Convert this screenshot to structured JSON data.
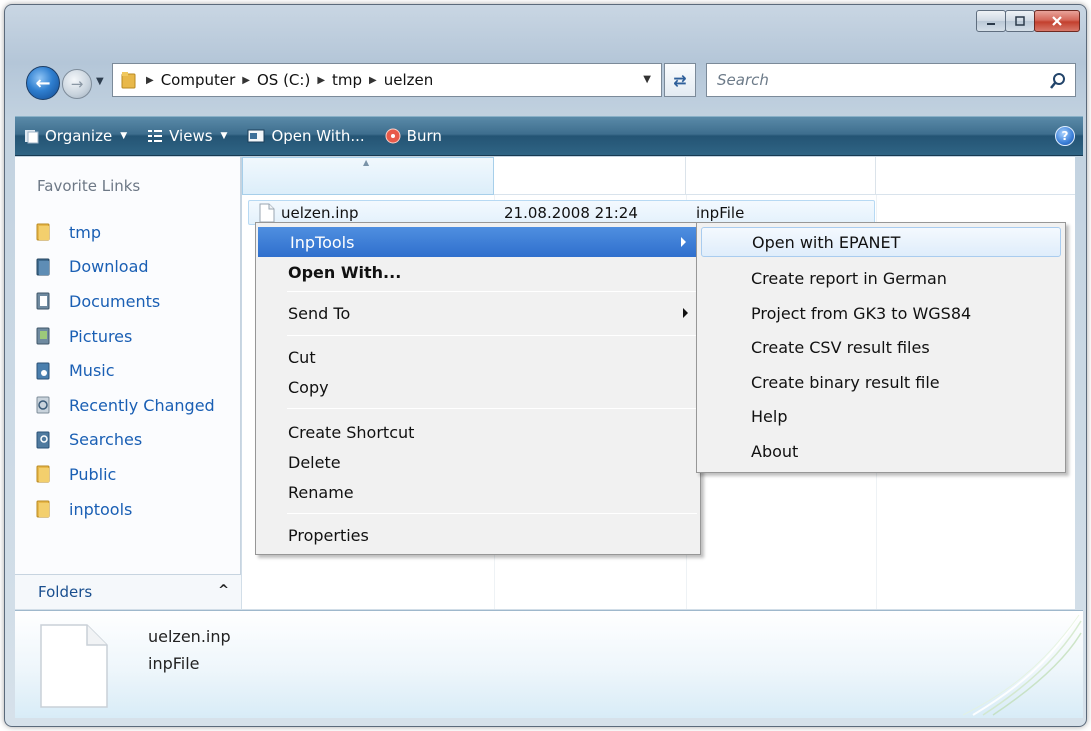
{
  "window": {
    "caption_buttons": {
      "minimize": "minimize-icon",
      "maximize": "maximize-icon",
      "close": "close-icon"
    }
  },
  "address_bar": {
    "crumbs": [
      "Computer",
      "OS (C:)",
      "tmp",
      "uelzen"
    ],
    "search_placeholder": "Search"
  },
  "toolbar": {
    "organize": "Organize",
    "views": "Views",
    "open_with": "Open With...",
    "burn": "Burn",
    "help": "?"
  },
  "sidebar": {
    "favorites_title": "Favorite Links",
    "items": [
      {
        "label": "tmp",
        "icon": "folder-icon"
      },
      {
        "label": "Download",
        "icon": "download-folder-icon"
      },
      {
        "label": "Documents",
        "icon": "documents-folder-icon"
      },
      {
        "label": "Pictures",
        "icon": "pictures-folder-icon"
      },
      {
        "label": "Music",
        "icon": "music-folder-icon"
      },
      {
        "label": "Recently Changed",
        "icon": "recent-folder-icon"
      },
      {
        "label": "Searches",
        "icon": "searches-folder-icon"
      },
      {
        "label": "Public",
        "icon": "folder-icon"
      },
      {
        "label": "inptools",
        "icon": "folder-icon"
      }
    ],
    "folders_label": "Folders"
  },
  "file_list": {
    "rows": [
      {
        "name": "uelzen.inp",
        "date": "21.08.2008 21:24",
        "type": "inpFile"
      }
    ]
  },
  "context_menu": {
    "items": {
      "inptools": "InpTools",
      "open_with": "Open With...",
      "send_to": "Send To",
      "cut": "Cut",
      "copy": "Copy",
      "create_shortcut": "Create Shortcut",
      "delete": "Delete",
      "rename": "Rename",
      "properties": "Properties"
    }
  },
  "submenu": {
    "items": [
      "Open with EPANET",
      "Create report in German",
      "Project from GK3 to WGS84",
      "Create CSV result files",
      "Create binary result file",
      "Help",
      "About"
    ]
  },
  "details": {
    "name": "uelzen.inp",
    "type": "inpFile"
  },
  "colors": {
    "toolbar": "#2f6484",
    "link": "#1a5fb4",
    "highlight": "#2f6fcd"
  }
}
